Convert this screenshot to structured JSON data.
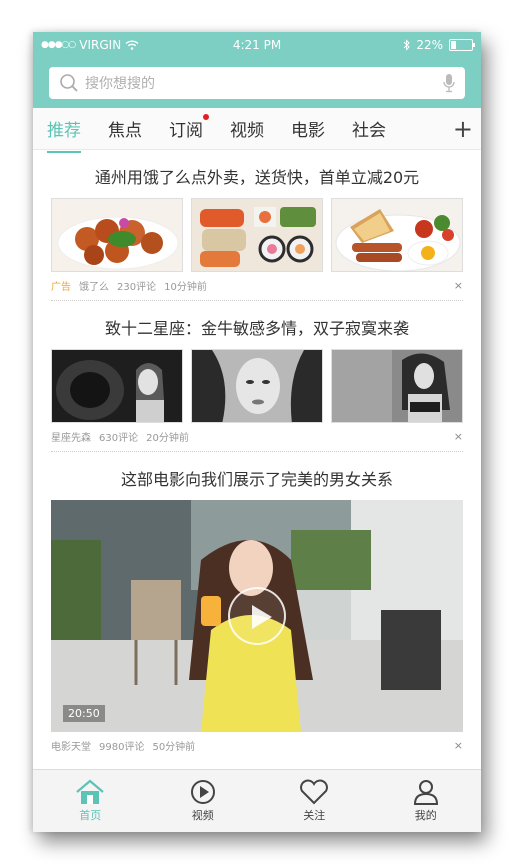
{
  "status": {
    "carrier": "VIRGIN",
    "time": "4:21 PM",
    "battery": "22%",
    "battery_level": 0.22
  },
  "search": {
    "placeholder": "搜你想搜的"
  },
  "tabs": [
    {
      "label": "推荐",
      "active": true
    },
    {
      "label": "焦点"
    },
    {
      "label": "订阅",
      "badge": true
    },
    {
      "label": "视频"
    },
    {
      "label": "电影"
    },
    {
      "label": "社会"
    }
  ],
  "tabs_plus": "+",
  "articles": [
    {
      "title": "通州用饿了么点外卖，送货快，首单立减20元",
      "ad": "广告",
      "source": "饿了么",
      "comments": "230评论",
      "time": "10分钟前",
      "close": "×"
    },
    {
      "title": "致十二星座：金牛敏感多情，双子寂寞来袭",
      "source": "星座先森",
      "comments": "630评论",
      "time": "20分钟前",
      "close": "×"
    },
    {
      "title": "这部电影向我们展示了完美的男女关系",
      "duration": "20:50",
      "source": "电影天堂",
      "comments": "9980评论",
      "time": "50分钟前",
      "close": "×"
    }
  ],
  "nav": [
    {
      "label": "首页",
      "icon": "home-icon",
      "active": true
    },
    {
      "label": "视频",
      "icon": "play-circle-icon"
    },
    {
      "label": "关注",
      "icon": "heart-icon"
    },
    {
      "label": "我的",
      "icon": "user-icon"
    }
  ],
  "colors": {
    "accent": "#5cc4b6",
    "header": "#7ccfc2",
    "ad": "#f2a33a",
    "badge": "#e02020"
  }
}
